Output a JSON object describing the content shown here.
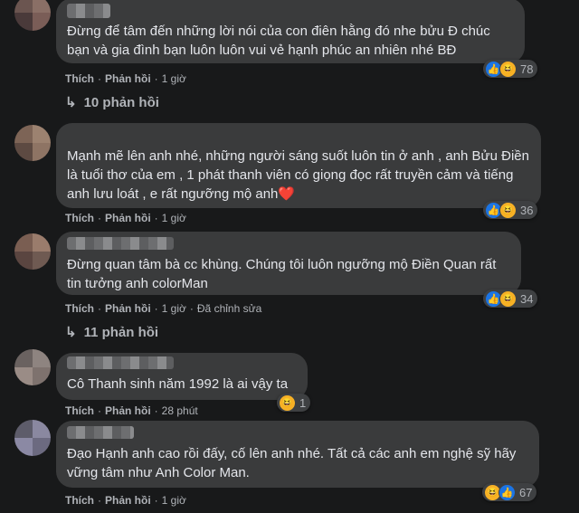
{
  "actions": {
    "like": "Thích",
    "reply": "Phản hồi",
    "sep": "·"
  },
  "comments": [
    {
      "text": "Đừng để tâm đến những lời nói của con điên hằng đó nhe bửu Đ chúc bạn và gia đình bạn luôn luôn vui vẻ hạnh phúc an nhiên nhé BĐ",
      "time": "1 giờ",
      "reactions": [
        "like-icon",
        "haha-icon"
      ],
      "count": "78",
      "replies": "10 phản hồi"
    },
    {
      "text": "Mạnh mẽ lên anh nhé, những người sáng suốt luôn tin ở anh , anh Bửu Điền là tuổi thơ của em , 1 phát thanh viên có giọng đọc rất truyền cảm và tiếng anh lưu loát , e rất ngưỡng mộ anh",
      "emoji": "❤️",
      "time": "1 giờ",
      "reactions": [
        "like-icon",
        "haha-icon"
      ],
      "count": "36"
    },
    {
      "text": "Đừng quan tâm bà cc khùng. Chúng tôi luôn ngưỡng mộ Điền Quan rất tin tưởng anh colorMan",
      "time": "1 giờ",
      "edited": "Đã chỉnh sửa",
      "reactions": [
        "like-icon",
        "haha-icon"
      ],
      "count": "34",
      "replies": "11 phản hồi"
    },
    {
      "text": "Cô Thanh sinh năm 1992 là ai vậy ta",
      "time": "28 phút",
      "reactions": [
        "haha-icon"
      ],
      "count": "1"
    },
    {
      "text": "Đạo Hạnh anh cao rồi đấy, cố lên anh nhé. Tất cả các anh em nghệ sỹ hãy vững tâm như Anh Color Man.",
      "time": "1 giờ",
      "reactions": [
        "haha-icon",
        "like-icon"
      ],
      "count": "67"
    }
  ],
  "colors": {
    "background": "#18191a",
    "bubble": "#3a3b3c",
    "like": "#1b74e4",
    "haha": "#f7b125",
    "heart": "#f02849"
  }
}
